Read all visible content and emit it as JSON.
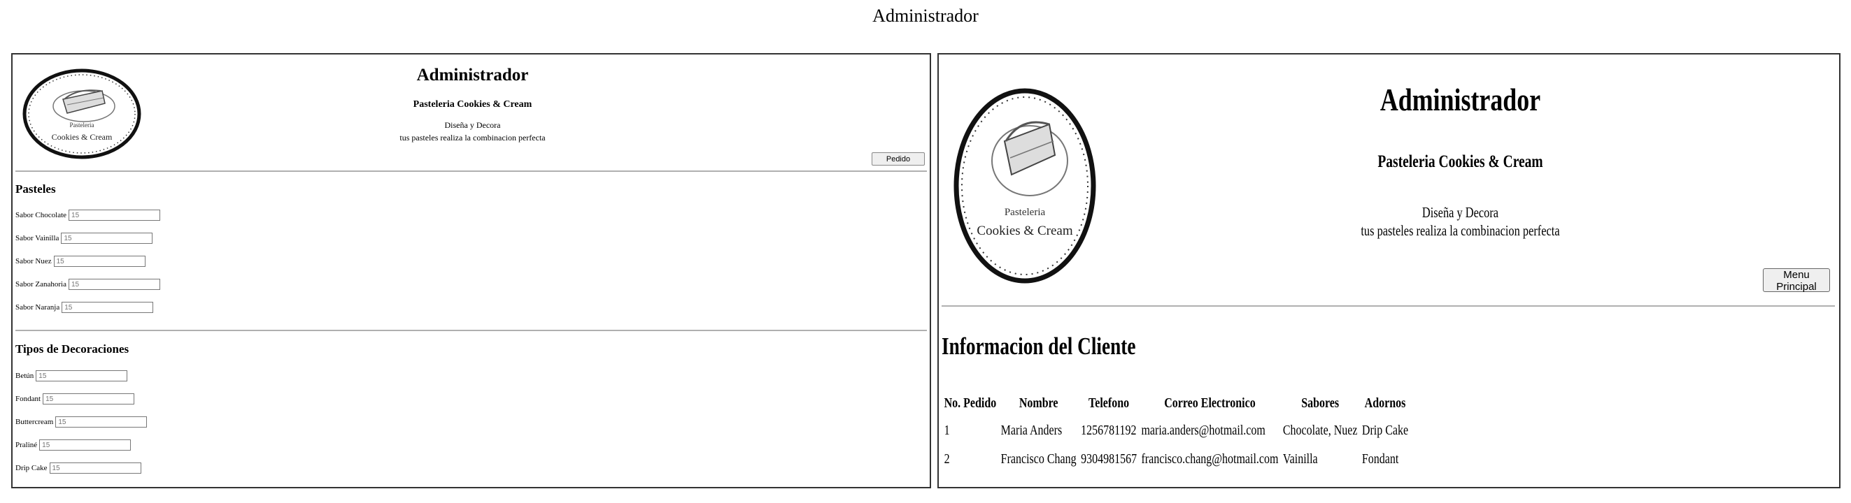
{
  "page": {
    "title": "Administrador"
  },
  "left_panel": {
    "logo": {
      "line1": "Pasteleria",
      "line2": "Cookies & Cream"
    },
    "title": "Administrador",
    "shop_name": "Pasteleria Cookies & Cream",
    "tagline1": "Diseña y Decora",
    "tagline2": "tus pasteles realiza la combinacion perfecta",
    "order_button": "Pedido",
    "flavors": {
      "heading": "Pasteles",
      "items": [
        {
          "label": "Sabor Chocolate",
          "value": "15"
        },
        {
          "label": "Sabor Vainilla",
          "value": "15"
        },
        {
          "label": "Sabor Nuez",
          "value": "15"
        },
        {
          "label": "Sabor Zanahoria",
          "value": "15"
        },
        {
          "label": "Sabor Naranja",
          "value": "15"
        }
      ]
    },
    "decorations": {
      "heading": "Tipos de Decoraciones",
      "items": [
        {
          "label": "Betún",
          "value": "15"
        },
        {
          "label": "Fondant",
          "value": "15"
        },
        {
          "label": "Buttercream",
          "value": "15"
        },
        {
          "label": "Praliné",
          "value": "15"
        },
        {
          "label": "Drip Cake",
          "value": "15"
        }
      ]
    }
  },
  "right_panel": {
    "logo": {
      "line1": "Pasteleria",
      "line2": "Cookies & Cream"
    },
    "title": "Administrador",
    "shop_name": "Pasteleria Cookies & Cream",
    "tagline1": "Diseña y Decora",
    "tagline2": "tus pasteles realiza la combinacion perfecta",
    "menu_button": "Menu Principal",
    "section_title": "Informacion del Cliente",
    "table": {
      "headers": [
        "No. Pedido",
        "Nombre",
        "Telefono",
        "Correo Electronico",
        "Sabores",
        "Adornos"
      ],
      "rows": [
        [
          "1",
          "Maria Anders",
          "1256781192",
          "maria.anders@hotmail.com",
          "Chocolate, Nuez",
          "Drip Cake"
        ],
        [
          "2",
          "Francisco Chang",
          "9304981567",
          "francisco.chang@hotmail.com",
          "Vainilla",
          "Fondant"
        ]
      ]
    }
  }
}
